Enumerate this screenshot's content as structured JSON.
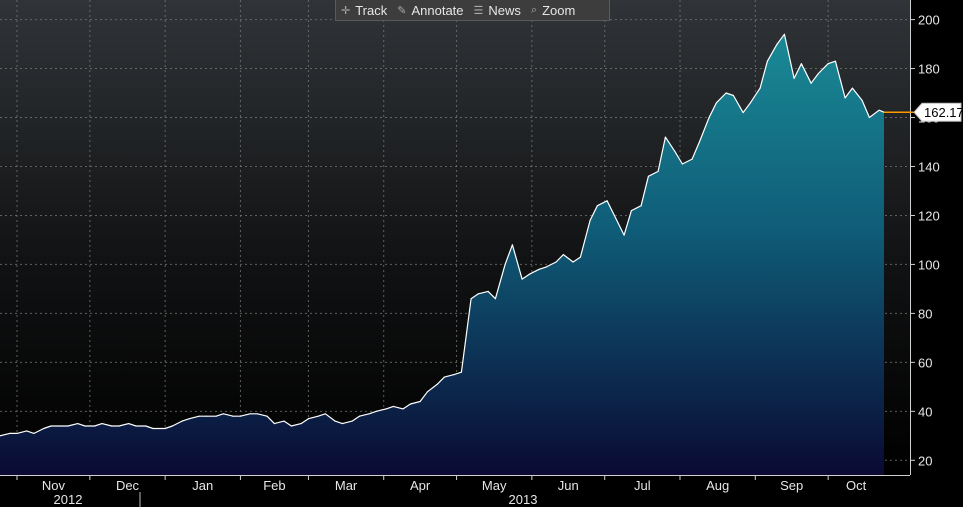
{
  "toolbar": {
    "buttons": [
      {
        "label": "Track",
        "icon": "crosshair-icon"
      },
      {
        "label": "Annotate",
        "icon": "pencil-icon"
      },
      {
        "label": "News",
        "icon": "news-icon"
      },
      {
        "label": "Zoom",
        "icon": "magnifier-icon"
      }
    ]
  },
  "chart_data": {
    "type": "area",
    "title": "",
    "xlabel": "",
    "ylabel": "",
    "ylim": [
      14,
      208
    ],
    "y_ticks": [
      20,
      40,
      60,
      80,
      100,
      120,
      140,
      160,
      180,
      200
    ],
    "x_tick_labels": [
      "Nov",
      "Dec",
      "Jan",
      "Feb",
      "Mar",
      "Apr",
      "May",
      "Jun",
      "Jul",
      "Aug",
      "Sep",
      "Oct"
    ],
    "year_labels": [
      "2012",
      "2013"
    ],
    "last_value_label": "162.17",
    "grid": true,
    "colors": {
      "line": "#ffffff",
      "area_top": "#1a8a96",
      "area_bottom": "#0a0a33",
      "last_marker": "#ff9900"
    },
    "series": [
      {
        "x": [
          "2012-10-25",
          "2012-10-29",
          "2012-11-01",
          "2012-11-05",
          "2012-11-08",
          "2012-11-12",
          "2012-11-15",
          "2012-11-19",
          "2012-11-22",
          "2012-11-26",
          "2012-11-29",
          "2012-12-03",
          "2012-12-06",
          "2012-12-10",
          "2012-12-13",
          "2012-12-17",
          "2012-12-20",
          "2012-12-24",
          "2012-12-27",
          "2013-01-01",
          "2013-01-04",
          "2013-01-08",
          "2013-01-11",
          "2013-01-15",
          "2013-01-18",
          "2013-01-22",
          "2013-01-25",
          "2013-01-29",
          "2013-02-01",
          "2013-02-05",
          "2013-02-08",
          "2013-02-12",
          "2013-02-15",
          "2013-02-19",
          "2013-02-22",
          "2013-02-26",
          "2013-03-01",
          "2013-03-05",
          "2013-03-08",
          "2013-03-12",
          "2013-03-15",
          "2013-03-19",
          "2013-03-22",
          "2013-03-26",
          "2013-03-29",
          "2013-04-02",
          "2013-04-05",
          "2013-04-09",
          "2013-04-12",
          "2013-04-16",
          "2013-04-19",
          "2013-04-23",
          "2013-04-26",
          "2013-04-30",
          "2013-05-03",
          "2013-05-07",
          "2013-05-10",
          "2013-05-14",
          "2013-05-17",
          "2013-05-21",
          "2013-05-24",
          "2013-05-28",
          "2013-05-31",
          "2013-06-04",
          "2013-06-07",
          "2013-06-11",
          "2013-06-14",
          "2013-06-18",
          "2013-06-21",
          "2013-06-25",
          "2013-06-28",
          "2013-07-02",
          "2013-07-05",
          "2013-07-09",
          "2013-07-12",
          "2013-07-16",
          "2013-07-19",
          "2013-07-23",
          "2013-07-26",
          "2013-07-30",
          "2013-08-02",
          "2013-08-06",
          "2013-08-09",
          "2013-08-13",
          "2013-08-16",
          "2013-08-20",
          "2013-08-23",
          "2013-08-27",
          "2013-08-30",
          "2013-09-03",
          "2013-09-06",
          "2013-09-10",
          "2013-09-13",
          "2013-09-17",
          "2013-09-20",
          "2013-09-24",
          "2013-09-27",
          "2013-10-01",
          "2013-10-04",
          "2013-10-08",
          "2013-10-11",
          "2013-10-15",
          "2013-10-18",
          "2013-10-22",
          "2013-10-24"
        ],
        "values": [
          30,
          31,
          31,
          32,
          31,
          33,
          34,
          34,
          34,
          35,
          34,
          34,
          35,
          34,
          34,
          35,
          34,
          34,
          33,
          33,
          34,
          36,
          37,
          38,
          38,
          38,
          39,
          38,
          38,
          39,
          39,
          38,
          35,
          36,
          34,
          35,
          37,
          38,
          39,
          36,
          35,
          36,
          38,
          39,
          40,
          41,
          42,
          41,
          43,
          44,
          48,
          51,
          54,
          55,
          56,
          86,
          88,
          89,
          86,
          100,
          108,
          94,
          96,
          98,
          99,
          101,
          104,
          101,
          103,
          118,
          124,
          126,
          120,
          112,
          122,
          124,
          136,
          138,
          152,
          146,
          141,
          143,
          150,
          160,
          166,
          170,
          169,
          162,
          166,
          172,
          183,
          190,
          194,
          176,
          182,
          174,
          178,
          182,
          183,
          168,
          172,
          167,
          160,
          163,
          162.17
        ]
      }
    ]
  }
}
